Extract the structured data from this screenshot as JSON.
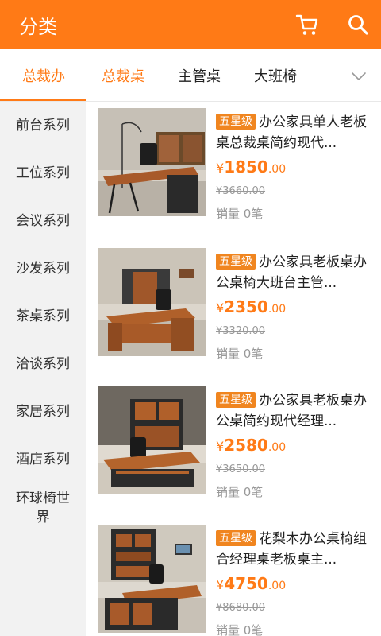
{
  "header": {
    "title": "分类",
    "cart_icon": "cart-icon",
    "search_icon": "search-icon"
  },
  "colors": {
    "accent": "#ff7a16",
    "badge": "#f0851f",
    "sidebar_bg": "#f2f2f2"
  },
  "tabs": [
    {
      "label": "总裁办",
      "active": true
    },
    {
      "label": "总裁桌",
      "active": false
    },
    {
      "label": "主管桌",
      "active": false
    },
    {
      "label": "大班椅",
      "active": false
    }
  ],
  "sidebar": {
    "items": [
      {
        "label": "前台系列"
      },
      {
        "label": "工位系列"
      },
      {
        "label": "会议系列"
      },
      {
        "label": "沙发系列"
      },
      {
        "label": "茶桌系列"
      },
      {
        "label": "洽谈系列"
      },
      {
        "label": "家居系列"
      },
      {
        "label": "酒店系列"
      },
      {
        "label": "环球椅世界"
      }
    ]
  },
  "products": [
    {
      "badge": "五星级",
      "title": "办公家具单人老板桌总裁桌简约现代...",
      "currency": "¥",
      "price_int": "1850",
      "price_dec": ".00",
      "original": "¥3660.00",
      "sales": "销量 0笔"
    },
    {
      "badge": "五星级",
      "title": "办公家具老板桌办公桌椅大班台主管...",
      "currency": "¥",
      "price_int": "2350",
      "price_dec": ".00",
      "original": "¥3320.00",
      "sales": "销量 0笔"
    },
    {
      "badge": "五星级",
      "title": "办公家具老板桌办公桌简约现代经理...",
      "currency": "¥",
      "price_int": "2580",
      "price_dec": ".00",
      "original": "¥3650.00",
      "sales": "销量 0笔"
    },
    {
      "badge": "五星级",
      "title": "花梨木办公桌椅组合经理桌老板桌主...",
      "currency": "¥",
      "price_int": "4750",
      "price_dec": ".00",
      "original": "¥8680.00",
      "sales": "销量 0笔"
    }
  ]
}
